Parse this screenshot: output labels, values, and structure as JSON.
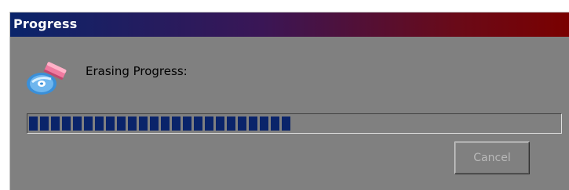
{
  "window": {
    "title": "Progress"
  },
  "dialog": {
    "icon": "cd-eraser-icon",
    "message": "Erasing Progress:"
  },
  "progress": {
    "percent": 50,
    "fill_color": "#0a246a"
  },
  "buttons": {
    "cancel_label": "Cancel",
    "cancel_enabled": false
  }
}
